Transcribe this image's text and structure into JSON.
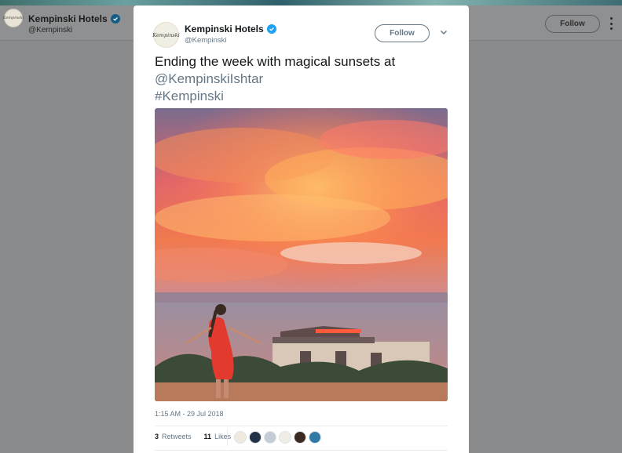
{
  "background_profile": {
    "logo_text": "Kempinski",
    "name": "Kempinski Hotels",
    "handle": "@Kempinski",
    "follow_label": "Follow"
  },
  "tweet": {
    "avatar_text": "Kempinski",
    "author_name": "Kempinski Hotels",
    "author_handle": "@Kempinski",
    "follow_label": "Follow",
    "text_line1": "Ending the week with magical sunsets at",
    "mention": "@KempinskiIshtar",
    "hashtag": "#Kempinski",
    "timestamp": "1:15 AM - 29 Jul 2018",
    "retweets_count": "3",
    "retweets_label": "Retweets",
    "likes_count": "11",
    "likes_label": "Likes"
  },
  "colors": {
    "verified": "#1da1f2",
    "overlay": "#8a8b8c",
    "secondary_text": "#657786"
  },
  "likers": [
    {
      "icon": "avatar-logo",
      "color": "#eeeae0"
    },
    {
      "icon": "avatar-photo",
      "color": "#243247"
    },
    {
      "icon": "avatar-default",
      "color": "#c4ccd6"
    },
    {
      "icon": "avatar-logo",
      "color": "#f0ede6"
    },
    {
      "icon": "avatar-photo",
      "color": "#3c2a20"
    },
    {
      "icon": "avatar-landscape",
      "color": "#2f7aa6"
    }
  ]
}
